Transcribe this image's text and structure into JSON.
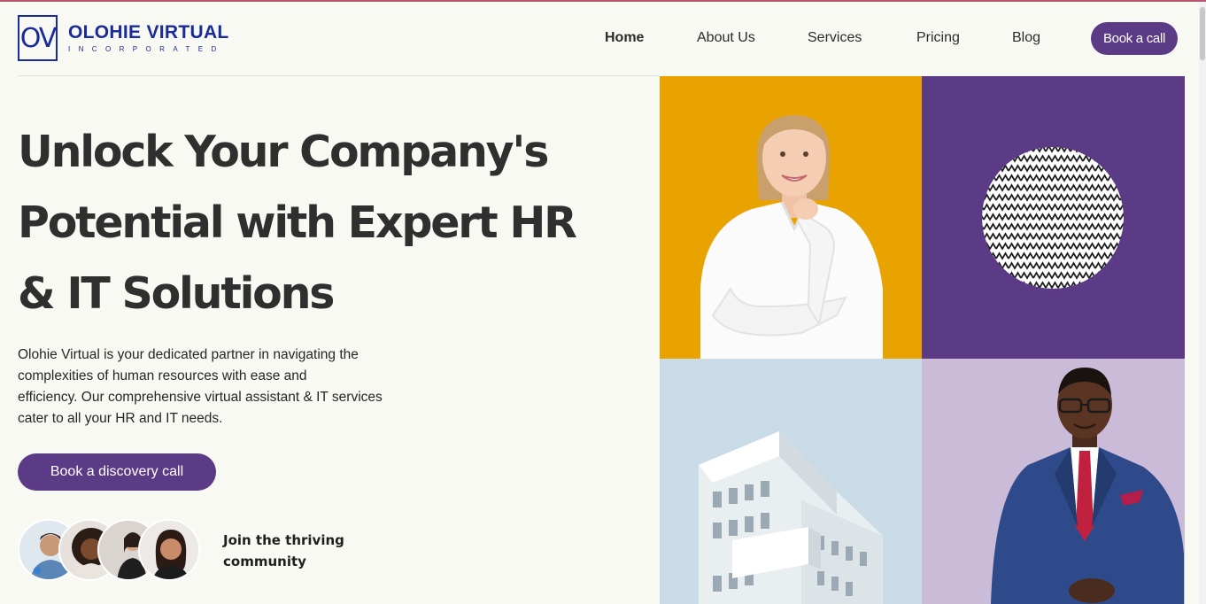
{
  "brand": {
    "monogram": "OV",
    "name": "OLOHIE VIRTUAL",
    "tagline": "INCORPORATED",
    "color": "#1a2b9a"
  },
  "nav": {
    "items": [
      {
        "label": "Home",
        "active": true
      },
      {
        "label": "About Us",
        "active": false
      },
      {
        "label": "Services",
        "active": false
      },
      {
        "label": "Pricing",
        "active": false
      },
      {
        "label": "Blog",
        "active": false
      }
    ],
    "cta_label": "Book a call"
  },
  "hero": {
    "title_line1": "Unlock Your Company's",
    "title_line2": "Potential with Expert HR",
    "title_line3": "& IT Solutions",
    "description_line1": "Olohie Virtual is your dedicated partner in navigating the",
    "description_line2": "complexities of human resources with ease and",
    "description_line3": "efficiency. Our comprehensive virtual assistant & IT services",
    "description_line4": "cater to all your HR and IT needs.",
    "cta_label": "Book a discovery call"
  },
  "community": {
    "line1": "Join the thriving",
    "line2": "community",
    "avatar_count": 4
  },
  "images": [
    {
      "name": "smiling-woman-photo",
      "background": "#e9a300"
    },
    {
      "name": "zigzag-pattern-circle",
      "background": "#5b3a86"
    },
    {
      "name": "white-building-photo",
      "background": "#c9dbe6"
    },
    {
      "name": "man-in-suit-photo",
      "background": "#cabcd9"
    }
  ],
  "colors": {
    "accent": "#5b3a86",
    "page_bg": "#f9f9f3",
    "text": "#2b2b2b"
  }
}
